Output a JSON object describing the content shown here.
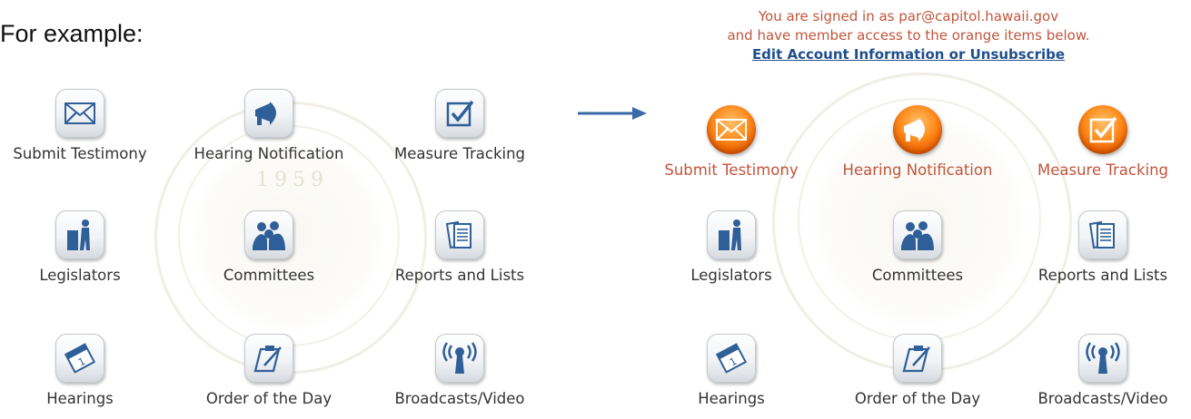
{
  "intro_text": "For example:",
  "right_panel": {
    "signed_in_line": "You are signed in as par@capitol.hawaii.gov",
    "access_line": "and have member access to the orange items below.",
    "edit_link": "Edit Account Information or Unsubscribe"
  },
  "left_tiles": [
    {
      "label": "Submit Testimony",
      "icon": "envelope-icon",
      "style": "gray"
    },
    {
      "label": "Hearing Notification",
      "icon": "megaphone-icon",
      "style": "gray"
    },
    {
      "label": "Measure Tracking",
      "icon": "checkbox-icon",
      "style": "gray"
    },
    {
      "label": "Legislators",
      "icon": "legislator-podium-icon",
      "style": "gray"
    },
    {
      "label": "Committees",
      "icon": "committee-people-icon",
      "style": "gray"
    },
    {
      "label": "Reports and Lists",
      "icon": "documents-icon",
      "style": "gray"
    },
    {
      "label": "Hearings",
      "icon": "calendar-icon",
      "style": "gray"
    },
    {
      "label": "Order of the Day",
      "icon": "clipboard-pen-icon",
      "style": "gray"
    },
    {
      "label": "Broadcasts/Video",
      "icon": "broadcast-antenna-icon",
      "style": "gray"
    }
  ],
  "right_tiles": [
    {
      "label": "Submit Testimony",
      "icon": "envelope-icon",
      "style": "orange"
    },
    {
      "label": "Hearing Notification",
      "icon": "megaphone-icon",
      "style": "orange"
    },
    {
      "label": "Measure Tracking",
      "icon": "checkbox-icon",
      "style": "orange"
    },
    {
      "label": "Legislators",
      "icon": "legislator-podium-icon",
      "style": "gray"
    },
    {
      "label": "Committees",
      "icon": "committee-people-icon",
      "style": "gray"
    },
    {
      "label": "Reports and Lists",
      "icon": "documents-icon",
      "style": "gray"
    },
    {
      "label": "Hearings",
      "icon": "calendar-icon",
      "style": "gray"
    },
    {
      "label": "Order of the Day",
      "icon": "clipboard-pen-icon",
      "style": "gray"
    },
    {
      "label": "Broadcasts/Video",
      "icon": "broadcast-antenna-icon",
      "style": "gray"
    }
  ],
  "colors": {
    "icon_blue": "#2f5f98",
    "orange_label": "#c2553b",
    "link_blue": "#1f4e8c",
    "arrow_blue": "#3b6aa8"
  }
}
